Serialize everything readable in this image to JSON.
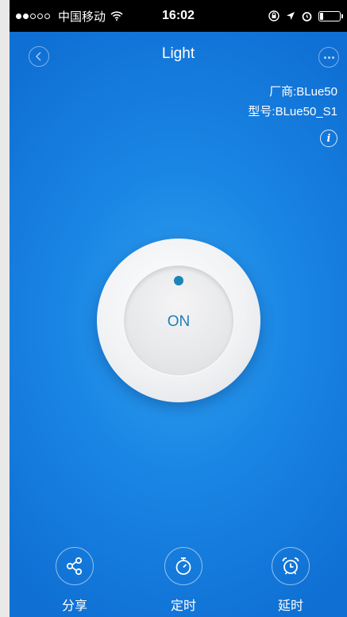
{
  "status_bar": {
    "carrier": "中国移动",
    "time": "16:02",
    "icons": [
      "signal-dots-icon",
      "wifi-icon",
      "lock-rotation-icon",
      "location-icon",
      "alarm-icon",
      "battery-icon"
    ],
    "battery_level": 0.15
  },
  "nav": {
    "title": "Light",
    "back_icon": "chevron-left-icon",
    "more_icon": "more-dots-icon"
  },
  "device_info": {
    "vendor": "厂商:BLue50",
    "model": "型号:BLue50_S1",
    "info_icon": "info-icon"
  },
  "power": {
    "label": "ON",
    "indicator_color": "#1a86b8"
  },
  "actions": [
    {
      "label": "分享",
      "icon": "share-icon"
    },
    {
      "label": "定时",
      "icon": "timer-icon"
    },
    {
      "label": "延时",
      "icon": "alarm-clock-icon"
    }
  ],
  "colors": {
    "background": "#1a86e4",
    "accent": "#1e7fb8"
  }
}
